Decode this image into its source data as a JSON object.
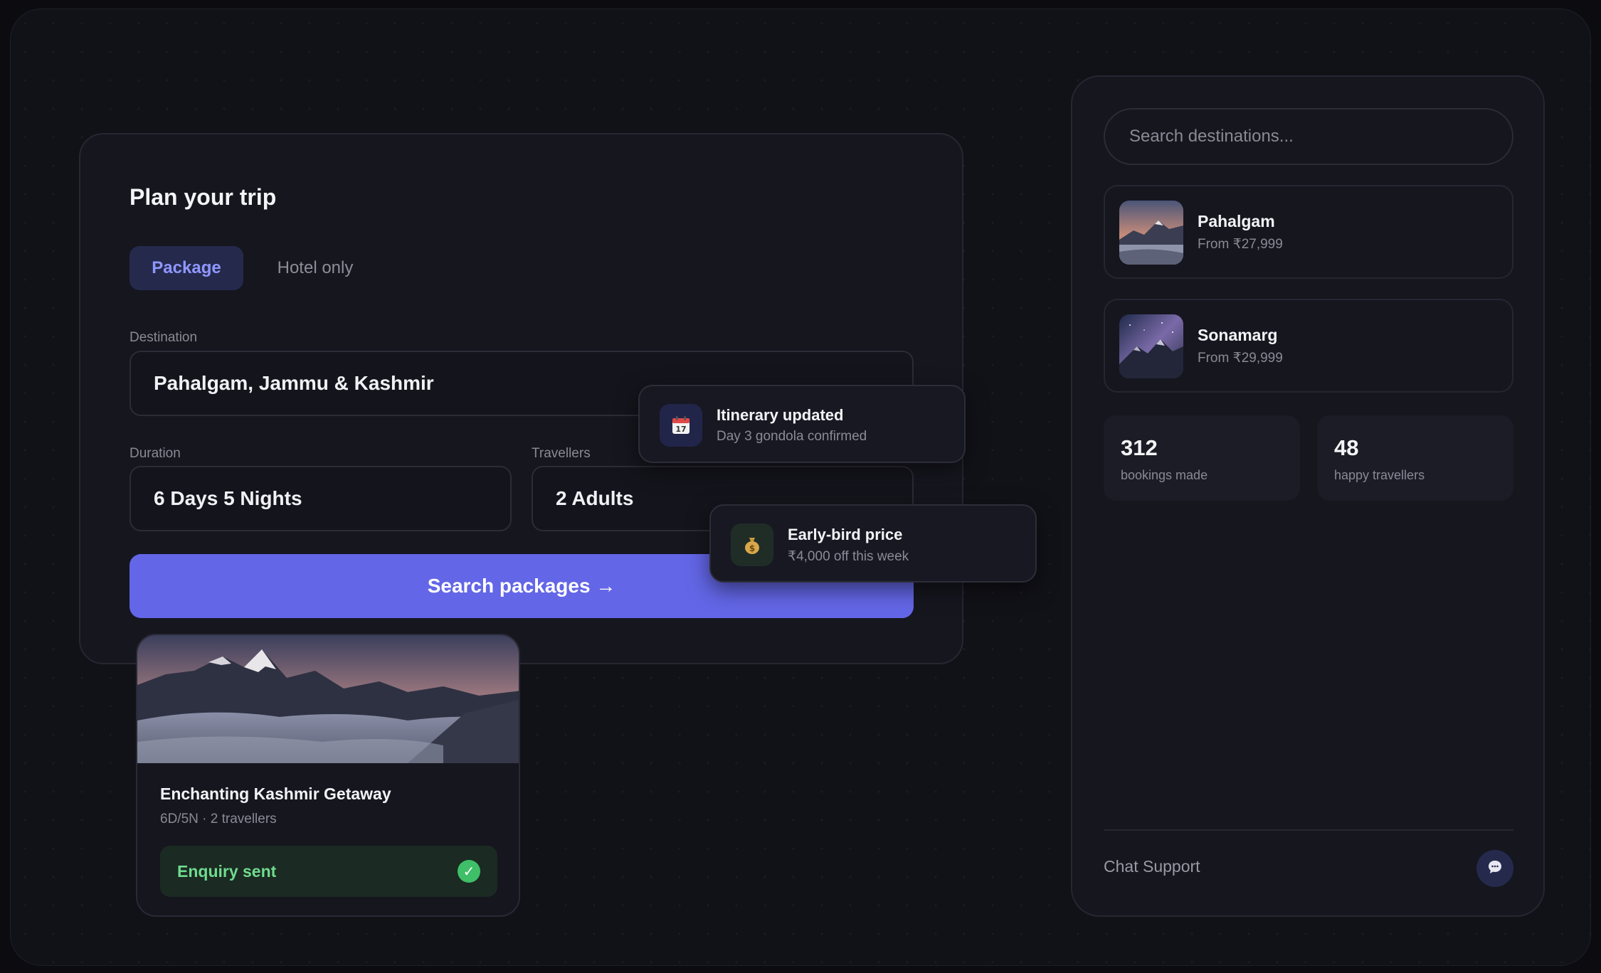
{
  "plan": {
    "title": "Plan your trip",
    "tabs": [
      {
        "label": "Package",
        "active": true
      },
      {
        "label": "Hotel only",
        "active": false
      }
    ],
    "destination": {
      "label": "Destination",
      "value": "Pahalgam, Jammu & Kashmir"
    },
    "duration": {
      "label": "Duration",
      "value": "6 Days 5 Nights"
    },
    "travellers": {
      "label": "Travellers",
      "value": "2 Adults"
    },
    "search_button": "Search packages →"
  },
  "toasts": [
    {
      "title": "Itinerary updated",
      "subtitle": "Day 3 gondola confirmed",
      "icon": "calendar-icon"
    },
    {
      "title": "Early-bird price",
      "subtitle": "₹4,000 off this week",
      "icon": "money-bag-icon"
    }
  ],
  "getaway": {
    "title": "Enchanting Kashmir Getaway",
    "meta": "6D/5N · 2 travellers",
    "status": "Enquiry sent",
    "status_icon": "check-icon"
  },
  "sidebar": {
    "search_placeholder": "Search destinations...",
    "destinations": [
      {
        "name": "Pahalgam",
        "price": "From ₹27,999"
      },
      {
        "name": "Sonamarg",
        "price": "From ₹29,999"
      }
    ],
    "stats": [
      {
        "value": "312",
        "label": "bookings made"
      },
      {
        "value": "48",
        "label": "happy travellers"
      }
    ],
    "chat_label": "Chat Support",
    "chat_icon": "chat-bubble-icon"
  },
  "colors": {
    "accent": "#6366e6",
    "background": "#111118",
    "card": "#16161f",
    "success": "#3fbf67"
  }
}
